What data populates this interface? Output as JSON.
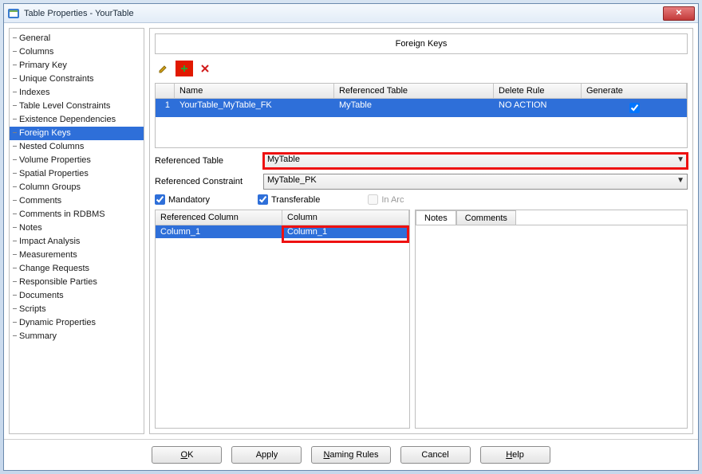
{
  "window": {
    "title": "Table Properties - YourTable"
  },
  "nav": {
    "items": [
      "General",
      "Columns",
      "Primary Key",
      "Unique Constraints",
      "Indexes",
      "Table Level Constraints",
      "Existence Dependencies",
      "Foreign Keys",
      "Nested Columns",
      "Volume Properties",
      "Spatial Properties",
      "Column Groups",
      "Comments",
      "Comments in RDBMS",
      "Notes",
      "Impact Analysis",
      "Measurements",
      "Change Requests",
      "Responsible Parties",
      "Documents",
      "Scripts",
      "Dynamic Properties",
      "Summary"
    ],
    "selected": "Foreign Keys"
  },
  "panel": {
    "title": "Foreign Keys"
  },
  "toolbar": {
    "edit": "✎",
    "add": "➕",
    "delete": "✖"
  },
  "fkgrid": {
    "headers": {
      "num": "",
      "name": "Name",
      "refTable": "Referenced Table",
      "deleteRule": "Delete Rule",
      "generate": "Generate"
    },
    "row": {
      "num": "1",
      "name": "YourTable_MyTable_FK",
      "refTable": "MyTable",
      "deleteRule": "NO ACTION",
      "generate_checked": true
    }
  },
  "form": {
    "refTableLabel": "Referenced Table",
    "refTableValue": "MyTable",
    "refConstraintLabel": "Referenced Constraint",
    "refConstraintValue": "MyTable_PK"
  },
  "checks": {
    "mandatory": "Mandatory",
    "transferable": "Transferable",
    "inarc": "In Arc",
    "mandatory_checked": true,
    "transferable_checked": true,
    "inarc_checked": false
  },
  "colgrid": {
    "headers": {
      "refcol": "Referenced Column",
      "col": "Column"
    },
    "row": {
      "refcol": "Column_1",
      "col": "Column_1"
    }
  },
  "tabs": {
    "notes": "Notes",
    "comments": "Comments"
  },
  "buttons": {
    "ok": "OK",
    "apply": "Apply",
    "naming": "Naming Rules",
    "cancel": "Cancel",
    "help": "Help"
  }
}
